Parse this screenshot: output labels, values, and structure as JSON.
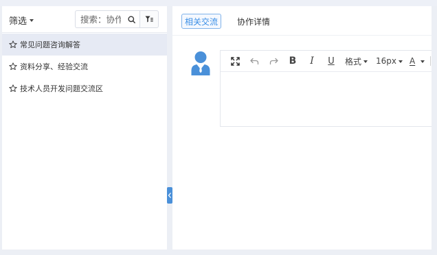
{
  "filter": {
    "label": "筛选",
    "search_placeholder": "搜索：协作",
    "search_icon": "search-icon",
    "filter_icon": "filter-icon"
  },
  "categories": [
    {
      "label": "常见问题咨询解答",
      "icon": "star-icon",
      "active": true
    },
    {
      "label": "资料分享、经验交流",
      "icon": "star-icon",
      "active": false
    },
    {
      "label": "技术人员开发问题交流区",
      "icon": "star-icon",
      "active": false
    }
  ],
  "tabs": [
    {
      "label": "相关交流",
      "active": true
    },
    {
      "label": "协作详情",
      "active": false
    }
  ],
  "editor": {
    "toolbar": {
      "fullscreen_icon": "fullscreen-icon",
      "undo_icon": "undo-icon",
      "redo_icon": "redo-icon",
      "bold_label": "B",
      "italic_label": "I",
      "underline_label": "U",
      "format_label": "格式",
      "font_size_label": "16px",
      "font_color_label": "A"
    }
  },
  "colors": {
    "accent": "#3a8ee6",
    "avatar": "#4a90d9",
    "active_item_bg": "#e6eaf4"
  }
}
